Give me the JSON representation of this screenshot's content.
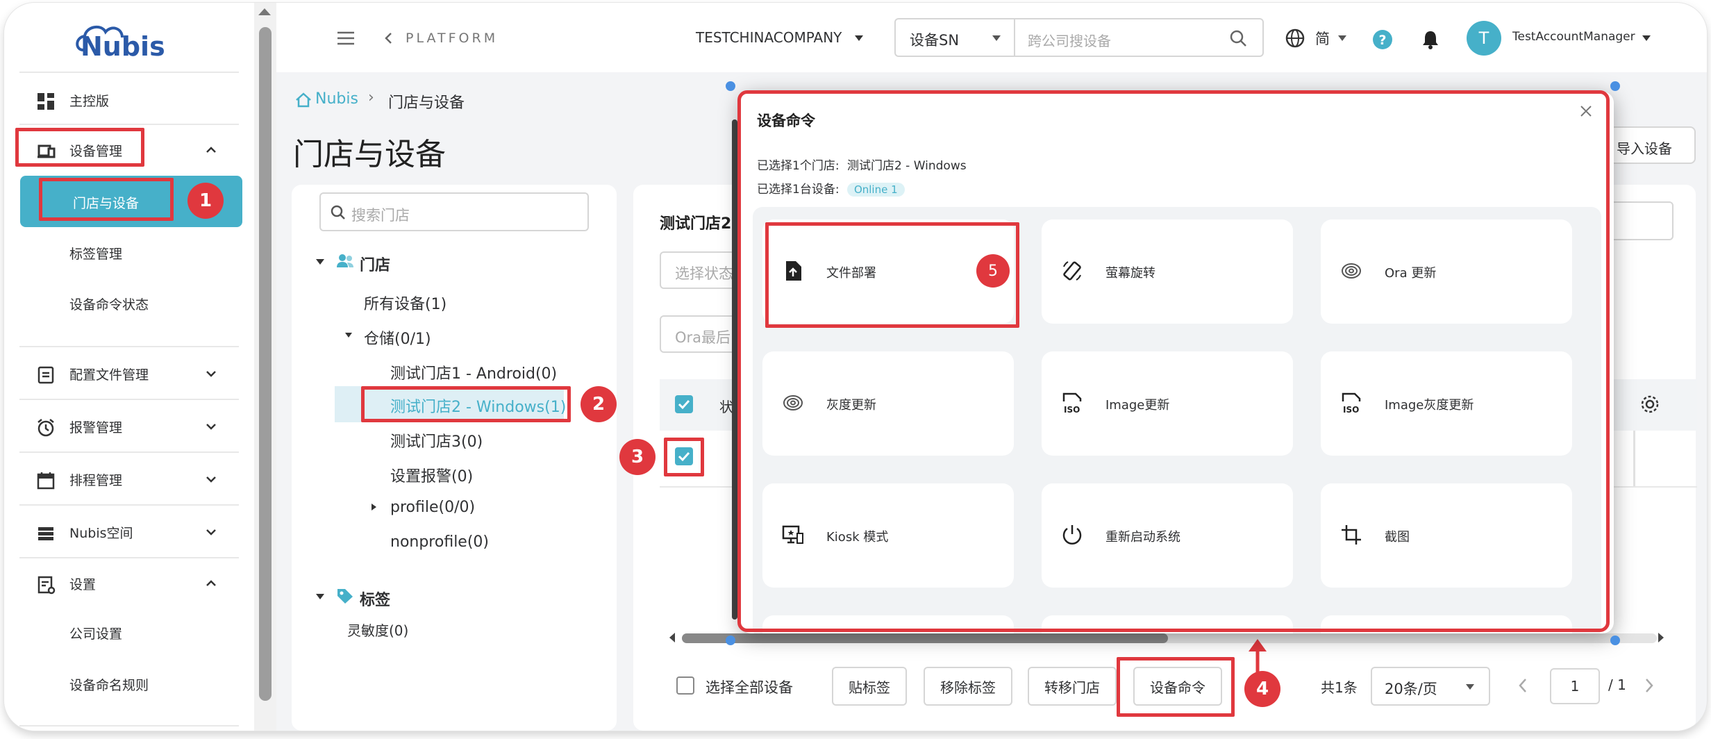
{
  "brand": {
    "logo_text": "Nubis"
  },
  "sidebar": {
    "dashboard": "主控版",
    "device_mgmt": "设备管理",
    "stores_devices": "门店与设备",
    "tag_mgmt": "标签管理",
    "cmd_status": "设备命令状态",
    "config_files": "配置文件管理",
    "alarm_mgmt": "报警管理",
    "schedule_mgmt": "排程管理",
    "space": "Nubis空间",
    "settings": "设置",
    "company_settings": "公司设置",
    "naming_rules": "设备命名规则"
  },
  "header": {
    "platform": "PLATFORM",
    "company": "TESTCHINACOMPANY",
    "search_type": "设备SN",
    "search_placeholder": "跨公司搜设备",
    "lang": "简",
    "avatar_letter": "T",
    "user": "TestAccountManager"
  },
  "breadcrumb": {
    "home": "Nubis",
    "current": "门店与设备"
  },
  "page_title": "门店与设备",
  "tree": {
    "search_placeholder": "搜索门店",
    "stores_header": "门店",
    "all_devices": "所有设备(1)",
    "warehouse": "仓储(0/1)",
    "store1": "测试门店1 - Android(0)",
    "store2": "测试门店2 - Windows(1)",
    "store3": "测试门店3(0)",
    "alarm_setting": "设置报警(0)",
    "profile": "profile(0/0)",
    "nonprofile": "nonprofile(0)",
    "tags_header": "标签",
    "sensitivity": "灵敏度(0)"
  },
  "devices": {
    "panel_title": "测试门店2",
    "status_filter_placeholder": "选择状态",
    "ora_filter_placeholder": "Ora最后",
    "col_status": "状",
    "import_button": "导入设备",
    "select_all": "选择全部设备",
    "btn_tag": "贴标签",
    "btn_remove_tag": "移除标签",
    "btn_transfer": "转移门店",
    "btn_command": "设备命令",
    "total": "共1条",
    "page_size": "20条/页",
    "page_current": "1",
    "page_total": "/ 1"
  },
  "modal": {
    "title": "设备命令",
    "selected_store_label": "已选择1个门店:",
    "selected_store": "测试门店2 - Windows",
    "selected_device_label": "已选择1台设备:",
    "online_badge": "Online 1",
    "commands": [
      {
        "label": "文件部署",
        "icon": "file-upload-icon"
      },
      {
        "label": "萤幕旋转",
        "icon": "screen-rotate-icon"
      },
      {
        "label": "Ora 更新",
        "icon": "ora-update-icon"
      },
      {
        "label": "灰度更新",
        "icon": "gray-update-icon"
      },
      {
        "label": "Image更新",
        "icon": "iso-image-icon"
      },
      {
        "label": "Image灰度更新",
        "icon": "iso-gray-image-icon"
      },
      {
        "label": "Kiosk 模式",
        "icon": "kiosk-icon"
      },
      {
        "label": "重新启动系统",
        "icon": "power-icon"
      },
      {
        "label": "截图",
        "icon": "crop-icon"
      }
    ]
  },
  "annotations": [
    "1",
    "2",
    "3",
    "4",
    "5"
  ],
  "colors": {
    "accent": "#46b0c9",
    "annotation": "#e0383e"
  }
}
